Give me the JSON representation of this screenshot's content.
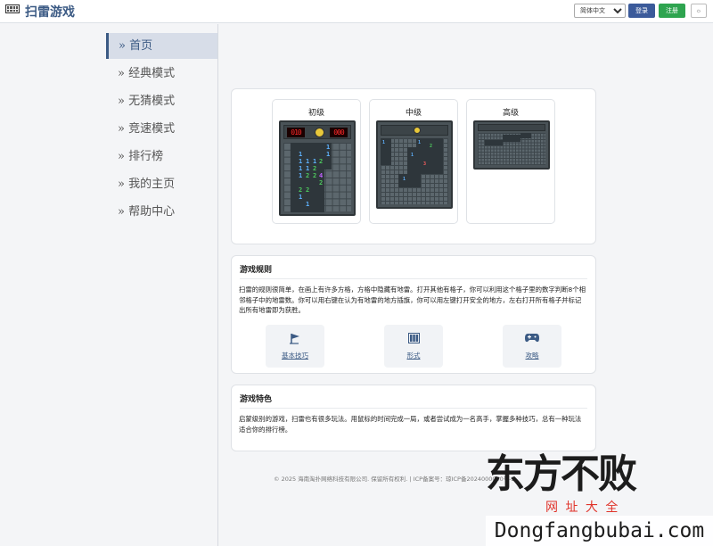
{
  "header": {
    "title": "扫雷游戏",
    "language": "简体中文",
    "login_label": "登录",
    "register_label": "注册",
    "theme_label": "☼"
  },
  "sidebar": {
    "items": [
      {
        "label": "» 首页",
        "active": true
      },
      {
        "label": "» 经典模式",
        "active": false
      },
      {
        "label": "» 无猜模式",
        "active": false
      },
      {
        "label": "» 竞速模式",
        "active": false
      },
      {
        "label": "» 排行榜",
        "active": false
      },
      {
        "label": "» 我的主页",
        "active": false
      },
      {
        "label": "» 帮助中心",
        "active": false
      }
    ]
  },
  "levels": [
    {
      "name": "初级",
      "mines": "010",
      "time": "000",
      "face": "smile-icon"
    },
    {
      "name": "中级",
      "mines": "",
      "time": "",
      "face": "smile-icon"
    },
    {
      "name": "高级",
      "mines": "",
      "time": "",
      "face": ""
    }
  ],
  "rules": {
    "title": "游戏规则",
    "text": "扫雷的规则很简单，在画上有许多方格，方格中隐藏有地雷。打开其他有格子，你可以利用这个格子里的数字判断8个相邻格子中的地雷数。你可以用右键在认为有地雷的地方插旗，你可以用左键打开安全的地方，左右打开所有格子并标记出所有地雷即为获胜。",
    "actions": [
      {
        "label": "基本技巧",
        "icon": "flag-icon"
      },
      {
        "label": "形式",
        "icon": "grid-icon"
      },
      {
        "label": "攻略",
        "icon": "gamepad-icon"
      }
    ]
  },
  "features": {
    "title": "游戏特色",
    "text": "启蒙级别的游戏，扫雷也有很多玩法。用鼠标的时间完成一局，或者尝试成为一名高手，掌握多种技巧，总有一种玩法适合你的排行榜。"
  },
  "footer": {
    "text": "© 2025 海南淘扑网络科技有限公司. 保留所有权利. | ICP备案号：琼ICP备2024000000号-2"
  },
  "watermark": {
    "main": "东方不败",
    "sub": "网 址 大 全",
    "url": "Dongfangbubai.com"
  },
  "colors": {
    "accent": "#3b5a84",
    "login": "#3b5a9a",
    "register": "#2ea44f",
    "board": "#4a5358",
    "led": "#ff2a2a",
    "num1": "#5fb3ff",
    "num2": "#4fcf5f",
    "num4": "#c060ff"
  }
}
